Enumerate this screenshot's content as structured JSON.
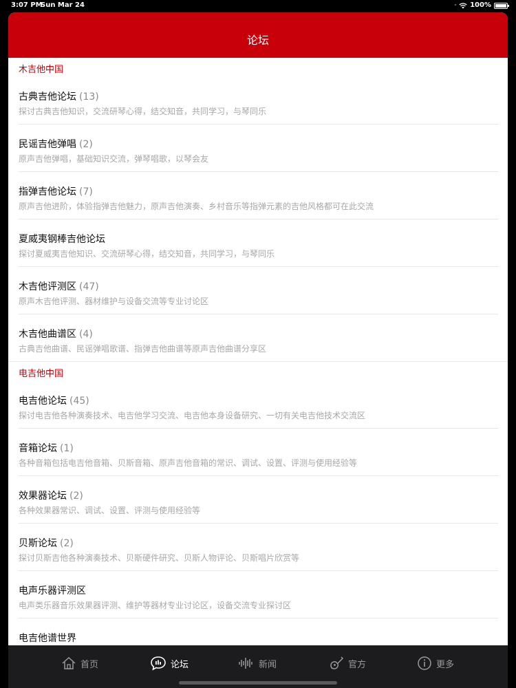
{
  "status_bar": {
    "time": "3:07 PM",
    "date": "Sun Mar 24",
    "battery_text": "100%",
    "battery_level": 1.0
  },
  "nav": {
    "title": "论坛"
  },
  "sections": [
    {
      "title": "木吉他中国",
      "forums": [
        {
          "name": "古典吉他论坛",
          "count": "(13)",
          "desc": "探讨古典吉他知识，交流研琴心得，结交知音，共同学习，与琴同乐"
        },
        {
          "name": "民谣吉他弹唱",
          "count": "(2)",
          "desc": "原声吉他弹唱，基础知识交流，弹琴唱歌，以琴会友"
        },
        {
          "name": "指弹吉他论坛",
          "count": "(7)",
          "desc": "原声吉他进阶，体验指弹吉他魅力，原声吉他演奏、乡村音乐等指弹元素的吉他风格都可在此交流"
        },
        {
          "name": "夏威夷钢棒吉他论坛",
          "count": "",
          "desc": "探讨夏威夷吉他知识、交流研琴心得，结交知音，共同学习，与琴同乐"
        },
        {
          "name": "木吉他评测区",
          "count": "(47)",
          "desc": "原声木吉他评测、器材维护与设备交流等专业讨论区"
        },
        {
          "name": "木吉他曲谱区",
          "count": "(4)",
          "desc": "古典吉他曲谱、民谣弹唱歌谱、指弹吉他曲谱等原声吉他曲谱分享区"
        }
      ]
    },
    {
      "title": "电吉他中国",
      "forums": [
        {
          "name": "电吉他论坛",
          "count": "(45)",
          "desc": "探讨电吉他各种演奏技术、电吉他学习交流、电吉他本身设备研究、一切有关电吉他技术交流区"
        },
        {
          "name": "音箱论坛",
          "count": "(1)",
          "desc": "各种音箱包括电吉他音箱、贝斯音箱、原声吉他音箱的常识、调试、设置、评测与使用经验等"
        },
        {
          "name": "效果器论坛",
          "count": "(2)",
          "desc": "各种效果器常识、调试、设置、评测与使用经验等"
        },
        {
          "name": "贝斯论坛",
          "count": "(2)",
          "desc": "探讨贝斯吉他各种演奏技术、贝斯硬件研究、贝斯人物评论、贝斯唱片欣赏等"
        },
        {
          "name": "电声乐器评测区",
          "count": "",
          "desc": "电声类乐器音乐效果器评测、维护等器材专业讨论区，设备交流专业探讨区"
        },
        {
          "name": "电吉他谱世界",
          "count": "",
          "desc": ""
        }
      ]
    }
  ],
  "tab_bar": {
    "tabs": [
      {
        "label": "首页",
        "icon": "home-icon",
        "active": false
      },
      {
        "label": "论坛",
        "icon": "forum-chat-icon",
        "active": true
      },
      {
        "label": "新闻",
        "icon": "sound-wave-icon",
        "active": false
      },
      {
        "label": "官方",
        "icon": "guitar-icon",
        "active": false
      },
      {
        "label": "更多",
        "icon": "info-icon",
        "active": false
      }
    ]
  },
  "colors": {
    "accent_red": "#c8000a",
    "tab_bar_bg": "#1c1c1e"
  }
}
